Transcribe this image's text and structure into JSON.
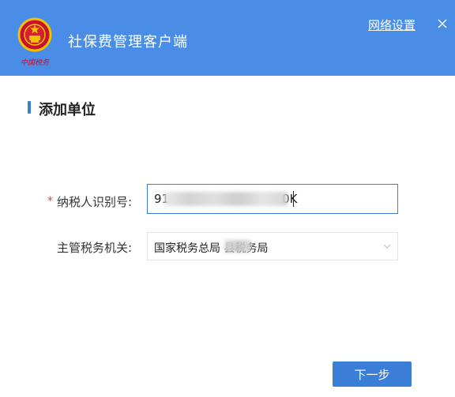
{
  "window": {
    "app_title": "社保费管理客户端",
    "network_settings_label": "网络设置",
    "close_glyph": "×",
    "emblem_caption": "中国税务"
  },
  "page": {
    "section_title": "添加单位"
  },
  "form": {
    "tax_id": {
      "required_mark": "*",
      "label": "纳税人识别号:",
      "value": "91                              0K"
    },
    "tax_bureau": {
      "label": "主管税务机关:",
      "value": "国家税务总局                    县税务局"
    }
  },
  "actions": {
    "next_label": "下一步"
  },
  "colors": {
    "header_bg": "#4a8de6",
    "accent": "#3b7ed8",
    "required": "#e04040"
  },
  "icons": {
    "emblem": "national-emblem-icon",
    "close": "close-icon",
    "dropdown": "chevron-down-icon"
  }
}
